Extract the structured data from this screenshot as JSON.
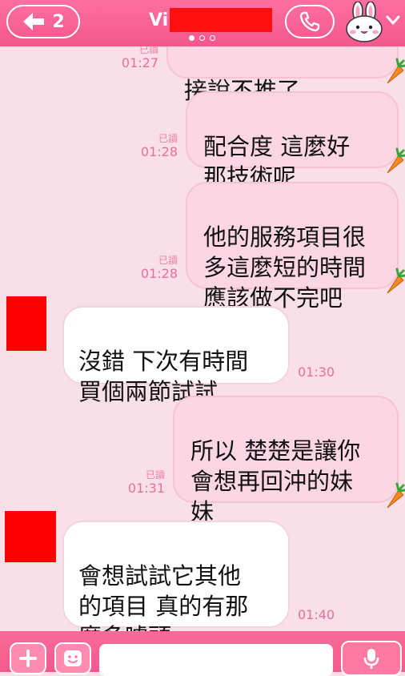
{
  "header": {
    "back_count": "2",
    "title_visible": "Vi",
    "page_dots": 3,
    "active_page": 1
  },
  "messages": [
    {
      "id": "m1",
      "side": "out",
      "text": "接說不推了",
      "read": "已讀",
      "time": "01:27"
    },
    {
      "id": "m2",
      "side": "out",
      "text": "配合度  這麼好\n那技術呢",
      "read": "已讀",
      "time": "01:28"
    },
    {
      "id": "m3",
      "side": "out",
      "text": "他的服務項目很\n多這麼短的時間\n應該做不完吧",
      "read": "已讀",
      "time": "01:28"
    },
    {
      "id": "m4",
      "side": "in",
      "text": "沒錯  下次有時間\n買個兩節試試",
      "time": "01:30"
    },
    {
      "id": "m5",
      "side": "out",
      "text": "所以  楚楚是讓你\n會想再回沖的妹\n妹",
      "read": "已讀",
      "time": "01:31"
    },
    {
      "id": "m6",
      "side": "in",
      "text": "會想試試它其他\n的項目  真的有那\n麼多噱頭",
      "time": "01:40"
    }
  ],
  "input": {
    "placeholder": ""
  },
  "colors": {
    "header": "#f2578c",
    "background": "#f9dfe8",
    "bubble_out": "#fcd6e2",
    "bubble_in": "#ffffff",
    "time_text": "#e86f96"
  },
  "icons": [
    "back-arrow-icon",
    "phone-icon",
    "bunny-avatar-icon",
    "chevron-down-icon",
    "carrot-sticker-icon",
    "plus-icon",
    "emoji-icon",
    "mic-icon"
  ]
}
